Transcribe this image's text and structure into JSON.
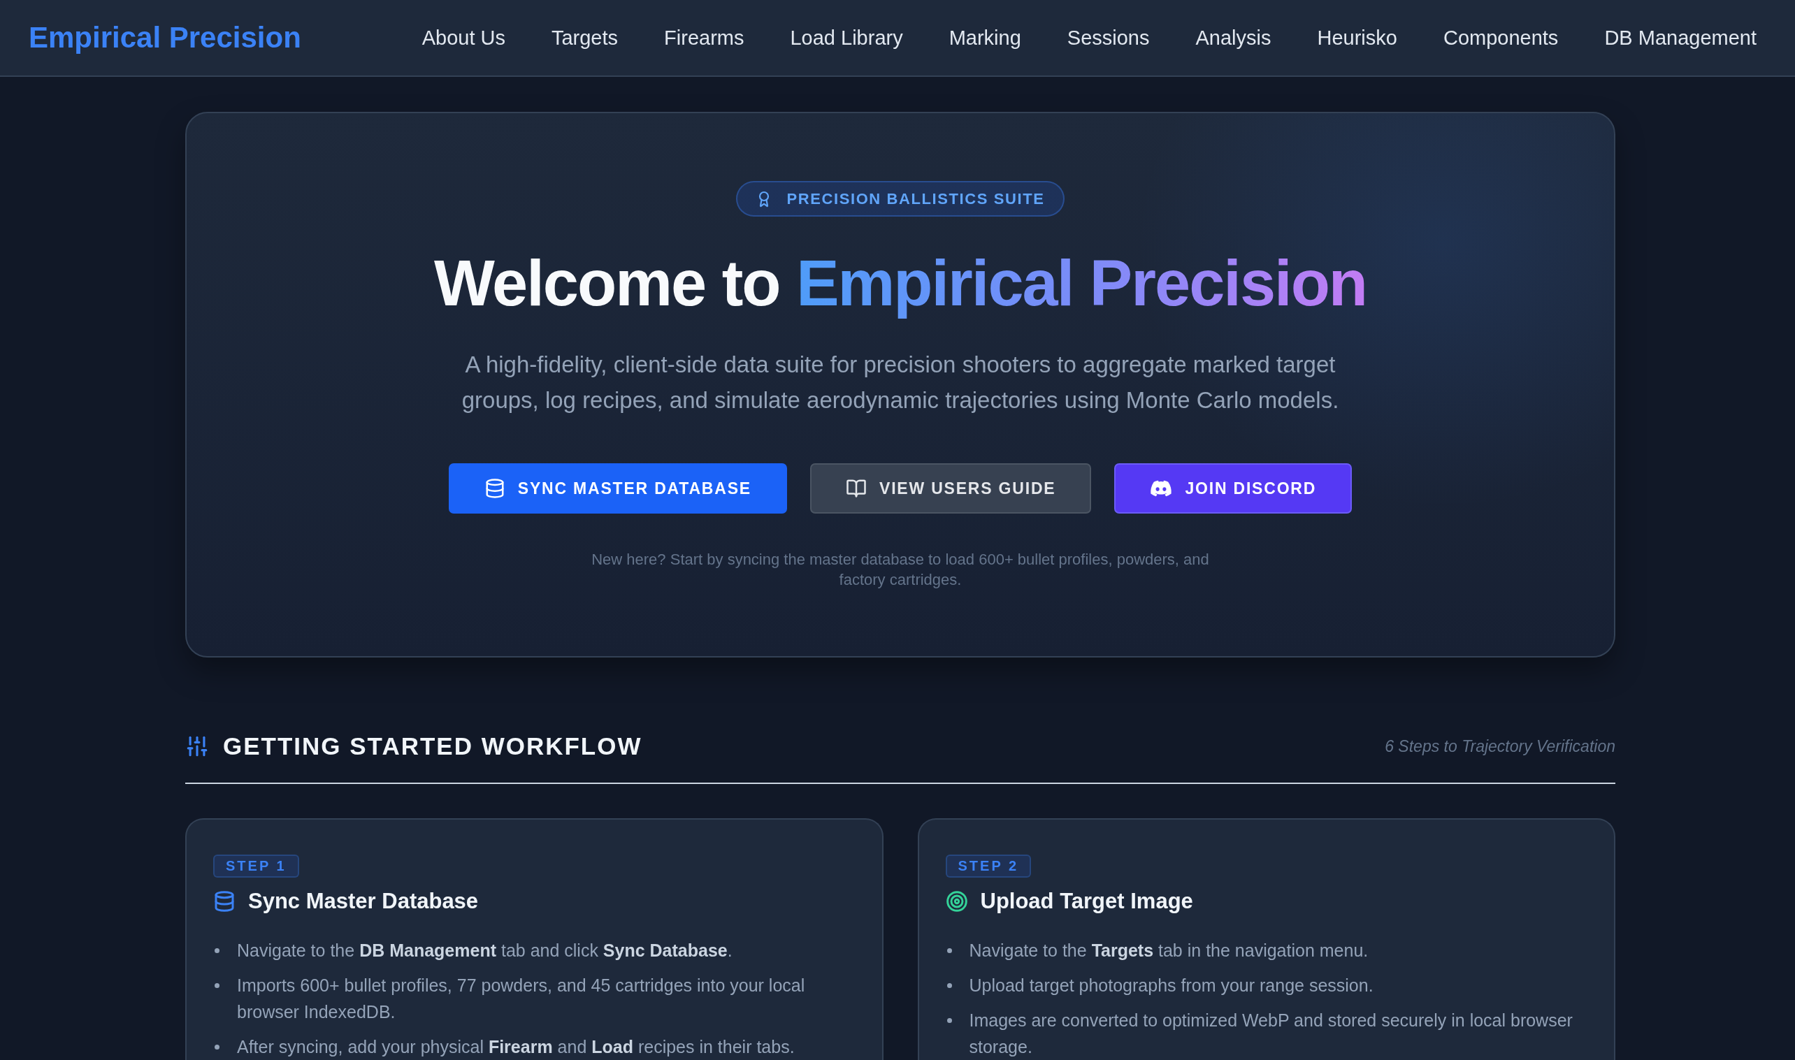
{
  "header": {
    "brand": "Empirical Precision",
    "nav": [
      "About Us",
      "Targets",
      "Firearms",
      "Load Library",
      "Marking",
      "Sessions",
      "Analysis",
      "Heurisko",
      "Components",
      "DB Management"
    ]
  },
  "hero": {
    "badge": "PRECISION BALLISTICS SUITE",
    "heading": {
      "lead": "Welcome to",
      "highlight": "Empirical Precision"
    },
    "subtitle": "A high-fidelity, client-side data suite for precision shooters to aggregate marked target groups, log recipes, and simulate aerodynamic trajectories using Monte Carlo models.",
    "buttons": [
      {
        "kind": "sync",
        "label": "SYNC MASTER DATABASE"
      },
      {
        "kind": "guide",
        "label": "VIEW USERS GUIDE"
      },
      {
        "kind": "discord",
        "label": "JOIN DISCORD"
      }
    ],
    "note": "New here? Start by syncing the master database to load 600+ bullet profiles, powders, and factory cartridges."
  },
  "workflow": {
    "title": "GETTING STARTED WORKFLOW",
    "subtitle": "6 Steps to Trajectory Verification",
    "steps": [
      {
        "badge": "STEP 1",
        "title": "Sync Master Database",
        "color": "#3b82f6",
        "bullets": [
          "Navigate to the **DB Management** tab and click **Sync Database**.",
          "Imports 600+ bullet profiles, 77 powders, and 45 cartridges into your local browser IndexedDB.",
          "After syncing, add your physical **Firearm** and **Load** recipes in their tabs."
        ]
      },
      {
        "badge": "STEP 2",
        "title": "Upload Target Image",
        "color": "#34d399",
        "bullets": [
          "Navigate to the **Targets** tab in the navigation menu.",
          "Upload target photographs from your range session.",
          "Images are converted to optimized WebP and stored securely in local browser storage."
        ]
      }
    ]
  }
}
